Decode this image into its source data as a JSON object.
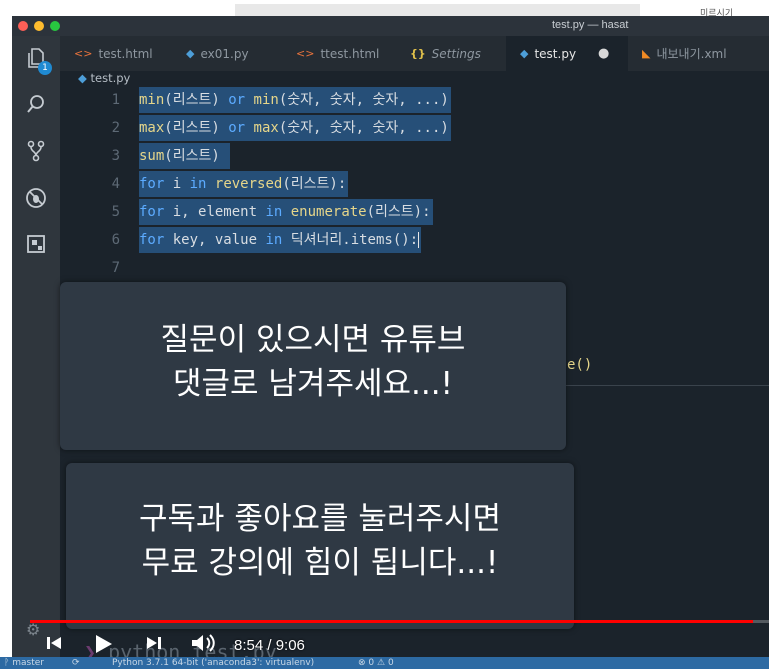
{
  "outer": {
    "corner_text": "미르시기"
  },
  "window": {
    "title": "test.py — hasat"
  },
  "activity_bar": {
    "items": [
      {
        "name": "explorer-icon",
        "badge": "1"
      },
      {
        "name": "search-icon"
      },
      {
        "name": "source-control-icon"
      },
      {
        "name": "debug-icon"
      },
      {
        "name": "extensions-icon"
      }
    ],
    "manage": "manage-gear-icon"
  },
  "tabs": [
    {
      "label": "test.html",
      "icon": "html-file-icon"
    },
    {
      "label": "ex01.py",
      "icon": "python-file-icon"
    },
    {
      "label": "ttest.html",
      "icon": "html-file-icon"
    },
    {
      "label": "Settings",
      "icon": "settings-braces-icon"
    },
    {
      "label": "test.py",
      "icon": "python-file-icon",
      "active": true,
      "dirty": "●"
    },
    {
      "label": "내보내기.xml",
      "icon": "rss-file-icon"
    }
  ],
  "breadcrumb": {
    "file": "test.py"
  },
  "code_lines": [
    {
      "num": "1",
      "parts": [
        [
          "fn",
          "min"
        ],
        [
          "t",
          "(리스트) "
        ],
        [
          "kw",
          "or"
        ],
        [
          "t",
          " "
        ],
        [
          "fn",
          "min"
        ],
        [
          "t",
          "(숫자, 숫자, 숫자, ...)"
        ]
      ]
    },
    {
      "num": "2",
      "parts": [
        [
          "fn",
          "max"
        ],
        [
          "t",
          "(리스트) "
        ],
        [
          "kw",
          "or"
        ],
        [
          "t",
          " "
        ],
        [
          "fn",
          "max"
        ],
        [
          "t",
          "(숫자, 숫자, 숫자, ...)"
        ]
      ]
    },
    {
      "num": "3",
      "parts": [
        [
          "fn",
          "sum"
        ],
        [
          "t",
          "(리스트) "
        ]
      ]
    },
    {
      "num": "4",
      "parts": [
        [
          "kw",
          "for"
        ],
        [
          "t",
          " i "
        ],
        [
          "kw",
          "in"
        ],
        [
          "t",
          " "
        ],
        [
          "fn",
          "reversed"
        ],
        [
          "t",
          "(리스트):"
        ]
      ]
    },
    {
      "num": "5",
      "parts": [
        [
          "kw",
          "for"
        ],
        [
          "t",
          " i, element "
        ],
        [
          "kw",
          "in"
        ],
        [
          "t",
          " "
        ],
        [
          "fn",
          "enumerate"
        ],
        [
          "t",
          "(리스트):"
        ]
      ]
    },
    {
      "num": "6",
      "parts": [
        [
          "kw",
          "for"
        ],
        [
          "t",
          " key, value "
        ],
        [
          "kw",
          "in"
        ],
        [
          "t",
          " 딕셔너리.items():"
        ]
      ],
      "cursor": true
    },
    {
      "num": "7",
      "parts": []
    }
  ],
  "peek_code": "e()",
  "overlays": {
    "top": [
      "질문이 있으시면 유튜브",
      "댓글로 남겨주세요...!"
    ],
    "bottom": [
      "구독과 좋아요를 눌러주시면",
      "무료 강의에 힘이 됩니다...!"
    ]
  },
  "terminal": {
    "prompt": "❯ ",
    "command": "python test.py"
  },
  "player": {
    "current_time": "8:54",
    "duration": "9:06",
    "time_display": "8:54 / 9:06",
    "progress": 0.978,
    "progress_color": "#ff0000"
  },
  "statusbar": {
    "branch": "master",
    "python": "Python 3.7.1 64-bit ('anaconda3': virtualenv)",
    "errors": "0",
    "warnings": "0"
  },
  "colors": {
    "editor_bg": "#1b232b",
    "selection": "#264f78",
    "keyword": "#5cabff",
    "function": "#e6d68a",
    "statusbar": "#2d6aa3"
  }
}
